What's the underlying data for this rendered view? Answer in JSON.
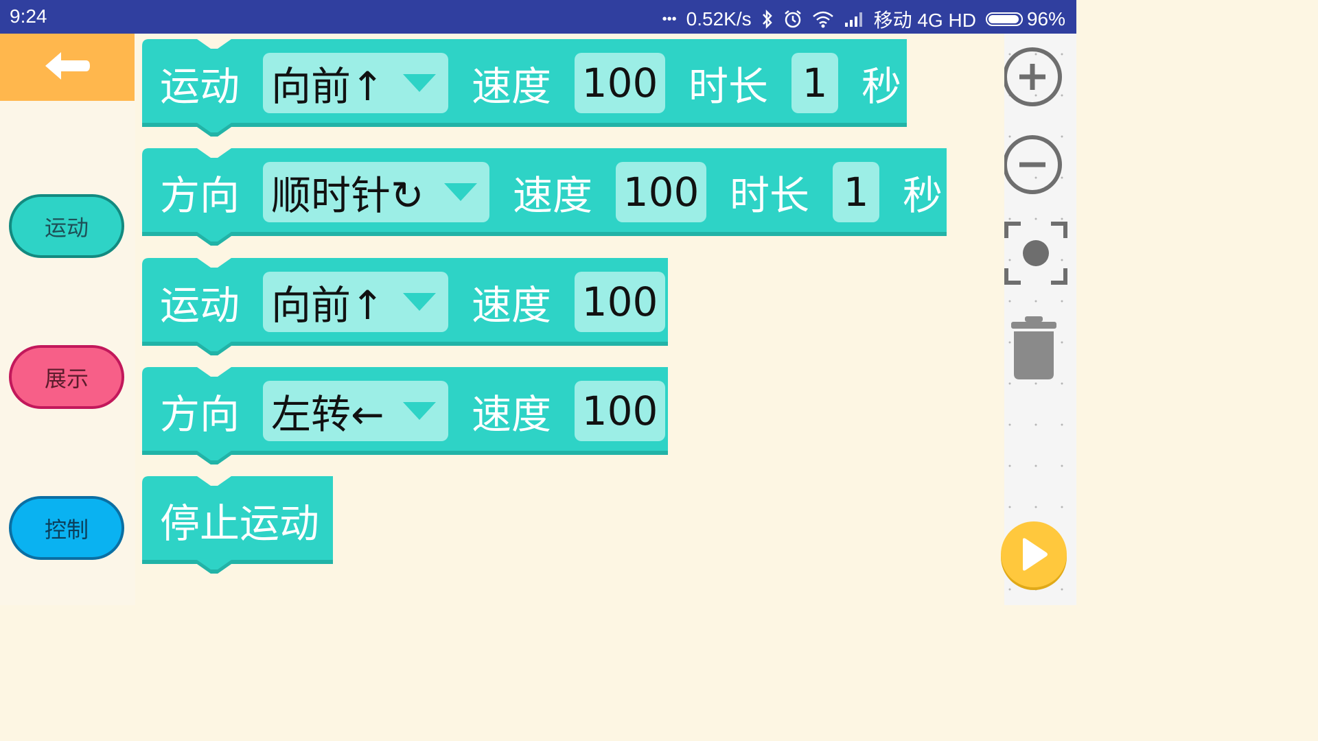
{
  "status_bar": {
    "time": "9:24",
    "more": "•••",
    "net_speed": "0.52K/s",
    "carrier": "移动 4G HD",
    "battery_text": "96%",
    "battery_level": 0.96,
    "icons": [
      "bluetooth-icon",
      "alarm-icon",
      "wifi-icon",
      "signal-icon",
      "battery-icon"
    ]
  },
  "categories": [
    {
      "label": "运动",
      "color": "#2ed3c6"
    },
    {
      "label": "展示",
      "color": "#f75f88"
    },
    {
      "label": "控制",
      "color": "#0ab2f1"
    }
  ],
  "blocks": [
    {
      "keyword": "运动",
      "dropdown": "向前↑",
      "speed_label": "速度",
      "speed": "100",
      "duration_label": "时长",
      "duration": "1",
      "unit": "秒"
    },
    {
      "keyword": "方向",
      "dropdown": "顺时针↻",
      "speed_label": "速度",
      "speed": "100",
      "duration_label": "时长",
      "duration": "1",
      "unit": "秒"
    },
    {
      "keyword": "运动",
      "dropdown": "向前↑",
      "speed_label": "速度",
      "speed": "100"
    },
    {
      "keyword": "方向",
      "dropdown": "左转←",
      "speed_label": "速度",
      "speed": "100"
    },
    {
      "keyword": "停止运动"
    }
  ],
  "toolbar": {
    "icons": [
      "zoom-in-icon",
      "zoom-out-icon",
      "recenter-icon",
      "trash-icon",
      "play-icon"
    ]
  },
  "colors": {
    "status_bar": "#303f9f",
    "block": "#2ed3c6",
    "block_field": "#9ceee6",
    "back_button": "#ffb74d",
    "play_button": "#ffc83d",
    "workspace": "#fdf6e3"
  }
}
